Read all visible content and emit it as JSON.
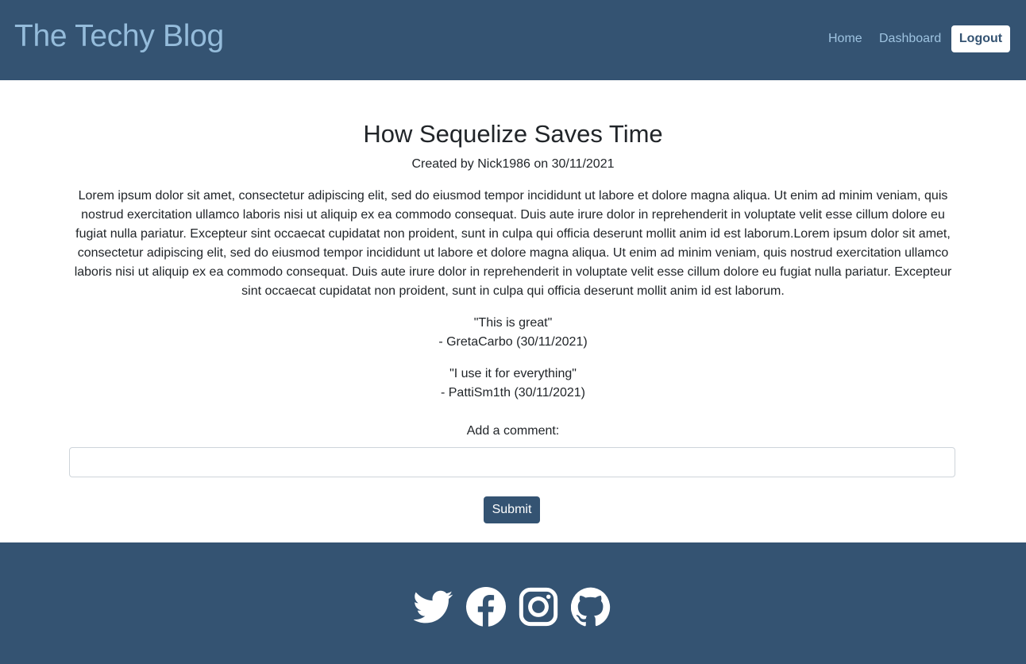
{
  "header": {
    "brand": "The Techy Blog",
    "nav": {
      "home": "Home",
      "dashboard": "Dashboard",
      "logout": "Logout"
    }
  },
  "post": {
    "title": "How Sequelize Saves Time",
    "meta": "Created by Nick1986 on 30/11/2021",
    "body": "Lorem ipsum dolor sit amet, consectetur adipiscing elit, sed do eiusmod tempor incididunt ut labore et dolore magna aliqua. Ut enim ad minim veniam, quis nostrud exercitation ullamco laboris nisi ut aliquip ex ea commodo consequat. Duis aute irure dolor in reprehenderit in voluptate velit esse cillum dolore eu fugiat nulla pariatur. Excepteur sint occaecat cupidatat non proident, sunt in culpa qui officia deserunt mollit anim id est laborum.Lorem ipsum dolor sit amet, consectetur adipiscing elit, sed do eiusmod tempor incididunt ut labore et dolore magna aliqua. Ut enim ad minim veniam, quis nostrud exercitation ullamco laboris nisi ut aliquip ex ea commodo consequat. Duis aute irure dolor in reprehenderit in voluptate velit esse cillum dolore eu fugiat nulla pariatur. Excepteur sint occaecat cupidatat non proident, sunt in culpa qui officia deserunt mollit anim id est laborum."
  },
  "comments": [
    {
      "text": "\"This is great\"",
      "author": "- GretaCarbo (30/11/2021)"
    },
    {
      "text": "\"I use it for everything\"",
      "author": "- PattiSm1th (30/11/2021)"
    }
  ],
  "comment_form": {
    "label": "Add a comment:",
    "value": "",
    "submit_label": "Submit"
  },
  "footer": {
    "social_icons": [
      "twitter-icon",
      "facebook-icon",
      "instagram-icon",
      "github-icon"
    ]
  },
  "colors": {
    "primary": "#345372",
    "brand_text": "#95bcdb",
    "nav_link": "#9ec3e0",
    "body_text": "#212529",
    "white": "#ffffff"
  }
}
